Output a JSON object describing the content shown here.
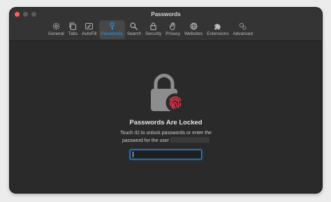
{
  "window": {
    "title": "Passwords"
  },
  "toolbar": {
    "items": [
      {
        "label": "General",
        "icon": "gear-icon"
      },
      {
        "label": "Tabs",
        "icon": "tabs-icon"
      },
      {
        "label": "AutoFill",
        "icon": "autofill-icon"
      },
      {
        "label": "Passwords",
        "icon": "key-icon",
        "selected": true
      },
      {
        "label": "Search",
        "icon": "magnifier-icon"
      },
      {
        "label": "Security",
        "icon": "lock-icon"
      },
      {
        "label": "Privacy",
        "icon": "hand-icon"
      },
      {
        "label": "Websites",
        "icon": "globe-icon"
      },
      {
        "label": "Extensions",
        "icon": "puzzle-icon"
      },
      {
        "label": "Advanced",
        "icon": "gears-icon"
      }
    ]
  },
  "locked": {
    "heading": "Passwords Are Locked",
    "line1": "Touch ID to unlock passwords or enter the",
    "line2": "password for the user",
    "password_value": ""
  },
  "colors": {
    "accent": "#1e9bff",
    "fingerprint": "#e8344a",
    "close": "#fe5f57"
  }
}
